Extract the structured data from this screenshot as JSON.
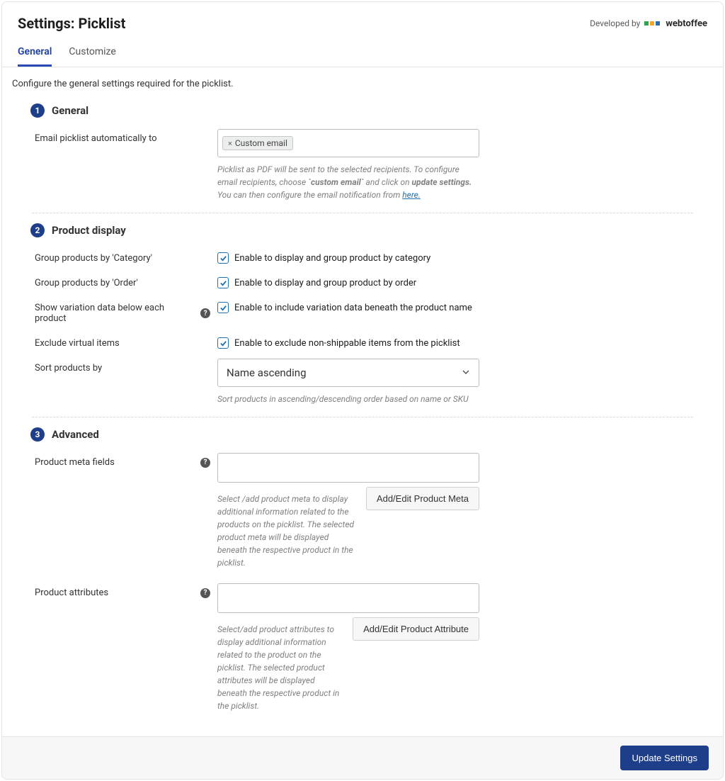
{
  "header": {
    "title": "Settings: Picklist",
    "developed_by": "Developed by",
    "brand": "webtoffee"
  },
  "tabs": {
    "general": "General",
    "customize": "Customize"
  },
  "intro": "Configure the general settings required for the picklist.",
  "section1": {
    "num": "1",
    "title": "General",
    "email_label": "Email picklist automatically to",
    "email_tag": "Custom email",
    "helper_pre": "Picklist as PDF will be sent to the selected recipients. To configure email recipients, choose ",
    "helper_ce": "`custom email`",
    "helper_mid": " and click on ",
    "helper_us": "update settings.",
    "helper_mid2": " You can then configure the email notification from ",
    "helper_link": "here."
  },
  "section2": {
    "num": "2",
    "title": "Product display",
    "group_cat_label": "Group products by 'Category'",
    "group_cat_desc": "Enable to display and group product by category",
    "group_order_label": "Group products by 'Order'",
    "group_order_desc": "Enable to display and group product by order",
    "variation_label": "Show variation data below each product",
    "variation_desc": "Enable to include variation data beneath the product name",
    "exclude_label": "Exclude virtual items",
    "exclude_desc": "Enable to exclude non-shippable items from the picklist",
    "sort_label": "Sort products by",
    "sort_value": "Name ascending",
    "sort_helper": "Sort products in ascending/descending order based on name or SKU"
  },
  "section3": {
    "num": "3",
    "title": "Advanced",
    "meta_label": "Product meta fields",
    "meta_helper": "Select /add product meta to display additional information related to the products on the picklist. The selected product meta will be displayed beneath the respective product in the picklist.",
    "meta_btn": "Add/Edit Product Meta",
    "attr_label": "Product attributes",
    "attr_helper": "Select/add product attributes to display additional information related to the product on the picklist. The selected product attributes will be displayed beneath the respective product in the picklist.",
    "attr_btn": "Add/Edit Product Attribute"
  },
  "footer": {
    "update": "Update Settings"
  },
  "help_glyph": "?"
}
